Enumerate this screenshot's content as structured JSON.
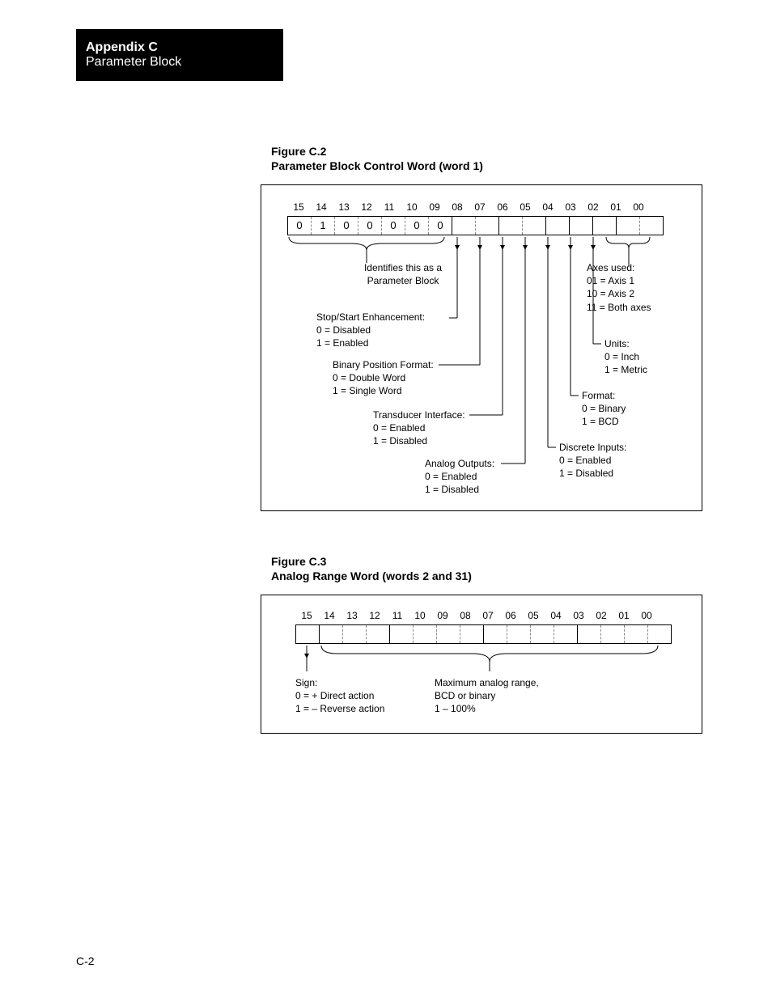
{
  "header": {
    "title": "Appendix C",
    "subtitle": "Parameter Block"
  },
  "page_number": "C-2",
  "fig_c2": {
    "label": "Figure C.2",
    "title": "Parameter Block Control Word (word 1)",
    "bits": [
      "15",
      "14",
      "13",
      "12",
      "11",
      "10",
      "09",
      "08",
      "07",
      "06",
      "05",
      "04",
      "03",
      "02",
      "01",
      "00"
    ],
    "values": [
      "0",
      "1",
      "0",
      "0",
      "0",
      "0",
      "0",
      "",
      "",
      "",
      "",
      "",
      "",
      "",
      "",
      ""
    ],
    "ann": {
      "identifies1": "Identifies this as a",
      "identifies2": "Parameter Block",
      "stop1": "Stop/Start Enhancement:",
      "stop2": "0 = Disabled",
      "stop3": "1 = Enabled",
      "bin1": "Binary Position Format:",
      "bin2": "0 = Double Word",
      "bin3": "1 = Single Word",
      "trans1": "Transducer Interface:",
      "trans2": "0 = Enabled",
      "trans3": "1 = Disabled",
      "ana1": "Analog Outputs:",
      "ana2": "0 = Enabled",
      "ana3": "1 = Disabled",
      "axes1": "Axes used:",
      "axes2": "01 = Axis 1",
      "axes3": "10 = Axis 2",
      "axes4": "11 = Both axes",
      "units1": "Units:",
      "units2": "0 = Inch",
      "units3": "1 = Metric",
      "fmt1": "Format:",
      "fmt2": "0 = Binary",
      "fmt3": "1 = BCD",
      "disc1": "Discrete Inputs:",
      "disc2": "0 = Enabled",
      "disc3": "1 = Disabled"
    }
  },
  "fig_c3": {
    "label": "Figure C.3",
    "title": "Analog Range Word (words 2 and 31)",
    "bits": [
      "15",
      "14",
      "13",
      "12",
      "11",
      "10",
      "09",
      "08",
      "07",
      "06",
      "05",
      "04",
      "03",
      "02",
      "01",
      "00"
    ],
    "ann": {
      "sign1": "Sign:",
      "sign2": "0 = + Direct action",
      "sign3": "1 = – Reverse action",
      "max1": "Maximum analog range,",
      "max2": "BCD or binary",
      "max3": "1 – 100%"
    }
  }
}
